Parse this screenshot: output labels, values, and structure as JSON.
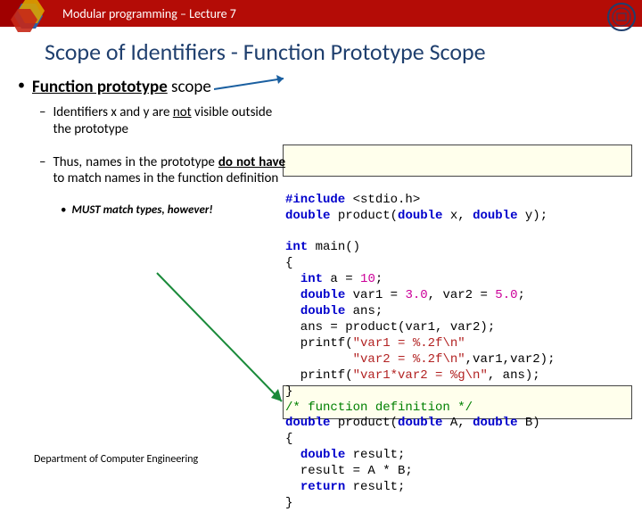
{
  "header": {
    "title": "Modular programming – Lecture 7"
  },
  "title": "Scope of Identifiers - Function Prototype Scope",
  "bullets": {
    "main_pre": "Function prototype",
    "main_post": " scope",
    "s1_pre": "Identifiers x and y are ",
    "s1_u": "not",
    "s1_post": " visible outside the prototype",
    "s2_pre": "Thus, names in the prototype ",
    "s2_ub": "do not have ",
    "s2_post": "to match names in the function definition",
    "s3": "MUST match types, however!"
  },
  "footer": "Department of Computer Engineering",
  "code": {
    "l1a": "#include",
    "l1b": " <stdio.h>",
    "l2a": "double",
    "l2b": " product(",
    "l2c": "double",
    "l2d": " x, ",
    "l2e": "double",
    "l2f": " y);",
    "blank": "",
    "l4a": "int",
    "l4b": " main()",
    "l5": "{",
    "l6a": "  ",
    "l6b": "int",
    "l6c": " a = ",
    "l6d": "10",
    "l6e": ";",
    "l7a": "  ",
    "l7b": "double",
    "l7c": " var1 = ",
    "l7d": "3.0",
    "l7e": ", var2 = ",
    "l7f": "5.0",
    "l7g": ";",
    "l8a": "  ",
    "l8b": "double",
    "l8c": " ans;",
    "l9": "  ans = product(var1, var2);",
    "l10a": "  printf(",
    "l10b": "\"var1 = %.2f\\n\"",
    "l11a": "         ",
    "l11b": "\"var2 = %.2f\\n\"",
    "l11c": ",var1,var2);",
    "l12a": "  printf(",
    "l12b": "\"var1*var2 = %g\\n\"",
    "l12c": ", ans);",
    "l13": "}",
    "l14": "/* function definition */",
    "l15a": "double",
    "l15b": " product(",
    "l15c": "double",
    "l15d": " A, ",
    "l15e": "double",
    "l15f": " B)",
    "l16": "{",
    "l17a": "  ",
    "l17b": "double",
    "l17c": " result;",
    "l18": "  result = A * B;",
    "l19a": "  ",
    "l19b": "return",
    "l19c": " result;",
    "l20": "}"
  }
}
